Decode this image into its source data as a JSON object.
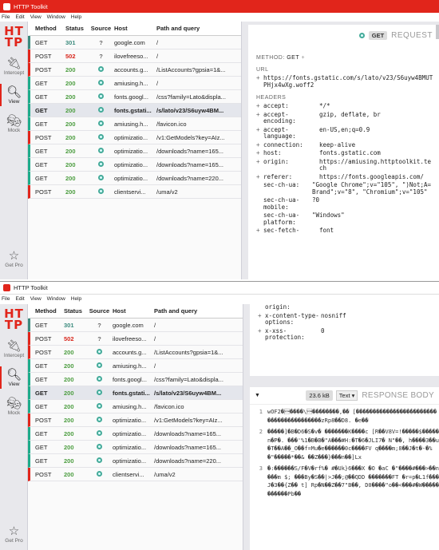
{
  "app": {
    "title": "HTTP Toolkit",
    "logo_line1": "HT",
    "logo_line2": "TP"
  },
  "menu": [
    "File",
    "Edit",
    "View",
    "Window",
    "Help"
  ],
  "nav": {
    "intercept": "Intercept",
    "view": "View",
    "mock": "Mock",
    "get_pro": "Get Pro"
  },
  "columns": {
    "method": "Method",
    "status": "Status",
    "source": "Source",
    "host": "Host",
    "path": "Path and query"
  },
  "rows": [
    {
      "method": "GET",
      "status": "301",
      "source": "?",
      "host": "google.com",
      "path": "/"
    },
    {
      "method": "POST",
      "status": "502",
      "source": "?",
      "host": "ilovefreeso...",
      "path": "/"
    },
    {
      "method": "POST",
      "status": "200",
      "source": "chrome",
      "host": "accounts.g...",
      "path": "/ListAccounts?gpsia=1&..."
    },
    {
      "method": "GET",
      "status": "200",
      "source": "chrome",
      "host": "amiusing.h...",
      "path": "/"
    },
    {
      "method": "GET",
      "status": "200",
      "source": "chrome",
      "host": "fonts.googl...",
      "path": "/css?family=Lato&displa..."
    },
    {
      "method": "GET",
      "status": "200",
      "source": "chrome",
      "host": "fonts.gstati...",
      "path": "/s/lato/v23/S6uyw4BM..."
    },
    {
      "method": "GET",
      "status": "200",
      "source": "chrome",
      "host": "amiusing.h...",
      "path": "/favicon.ico"
    },
    {
      "method": "POST",
      "status": "200",
      "source": "chrome",
      "host": "optimizatio...",
      "path": "/v1:GetModels?key=AIz..."
    },
    {
      "method": "GET",
      "status": "200",
      "source": "chrome",
      "host": "optimizatio...",
      "path": "/downloads?name=165..."
    },
    {
      "method": "GET",
      "status": "200",
      "source": "chrome",
      "host": "optimizatio...",
      "path": "/downloads?name=165..."
    },
    {
      "method": "GET",
      "status": "200",
      "source": "chrome",
      "host": "optimizatio...",
      "path": "/downloads?name=220..."
    },
    {
      "method": "POST",
      "status": "200",
      "source": "chrome",
      "host": "clientservi...",
      "path": "/uma/v2"
    }
  ],
  "request": {
    "method_pill": "GET",
    "title": "REQUEST",
    "method_label": "METHOD:",
    "method_value": "GET",
    "url_label": "URL",
    "url": "https://fonts.gstatic.com/s/lato/v23/S6uyw4BMUTPHjx4wXg.woff2",
    "headers_label": "HEADERS",
    "headers": [
      {
        "k": "accept:",
        "v": "*/*",
        "plus": true
      },
      {
        "k": "accept-encoding:",
        "v": "gzip, deflate, br",
        "plus": true
      },
      {
        "k": "accept-language:",
        "v": "en-US,en;q=0.9",
        "plus": true
      },
      {
        "k": "connection:",
        "v": "keep-alive",
        "plus": true
      },
      {
        "k": "host:",
        "v": "fonts.gstatic.com",
        "plus": true
      },
      {
        "k": "origin:",
        "v": "https://amiusing.httptoolkit.tech",
        "plus": true
      },
      {
        "k": "referer:",
        "v": "https://fonts.googleapis.com/",
        "plus": true
      },
      {
        "k": "sec-ch-ua:",
        "v": "\"Google Chrome\";v=\"105\", \")Not;A=Brand\";v=\"8\", \"Chromium\";v=\"105\"",
        "plus": false
      },
      {
        "k": "sec-ch-ua-mobile:",
        "v": "?0",
        "plus": false
      },
      {
        "k": "sec-ch-ua-platform:",
        "v": "\"Windows\"",
        "plus": false
      },
      {
        "k": "sec-fetch-",
        "v": "font",
        "plus": true
      }
    ]
  },
  "response_headers_tail": [
    {
      "k": "origin:",
      "v": "",
      "plus": false
    },
    {
      "k": "x-content-type-options:",
      "v": "nosniff",
      "plus": true
    },
    {
      "k": "x-xss-protection:",
      "v": "0",
      "plus": true
    }
  ],
  "response_body": {
    "size": "23.6 kB",
    "format": "Text",
    "title": "RESPONSE BODY",
    "lines": [
      {
        "n": "1",
        "text": "wOF2\u0000\u0001\u0000\u0000\u0000\u0000\\\u0001\u0000\u0000\u0000\u0000\u0000\u0000\u0000\u0000,\u0000\u0000 [\u0000\u0000\u0000\u0000\u0000\u0000\u0000\u0000\u0000\u0000\u0000\u0000\u0000\u0000\u0000\u0000\u0000\u0000\u0000\u0000\u0000\u0000\u0000\u0000\u0000\u0000\u0000\u0000\u0000\u0000\u0000\u0000\u0000\u0000\u0000\u0000\u0000\u0000\u0000\u0000zRp8\u0000\u0000D8. \u0000e\u0000\u0000"
      },
      {
        "n": "2",
        "text": "\u0000\u0000\u0000\u0000\u0000]\u0000B\u0000D6\u0000S\u0000v\u0000 \u0000\u0000\u0000\u0000\u0000\u0000\u0000K\u0000\u0000\u0000\u0000c [R\u0000\u0000V8V=!\u0000\u0000\u0000\u0000\u0000$\u0000\u0000\u0000\u0000\u0000n\u0000P\u0000. \u0000\u0000\u0000'%1\u0000B\u0000B\u0000\"A\u0000\u0000\u0000#H:\u0000T\u00006\u0000JLI7\u0000 N\"\u0000\u0000, h\u0000\u0000\u0000\u00003\u0000\u0000u\u0000T\u0000\u0000A\u0000\u0000_O\u0000\u0000f=Mu\u0000e\u0000\u0000\u0000\u0000\u0000\u00000c\u0000\u0000\u0000\u0000FV q\u0000\u0000\u0000\u0000m;8\u0000\u0000J\u0000t\u0000-\u0000%\u0000\"\u0000\u0000\u0000\u0000\u0000*\u0000\u0000& \u0000\u0000Z\u0000\u0000\u0000}\u0000\u0000\u0000n\u0000\u0000]Lx"
      },
      {
        "n": "3",
        "text": "\u0000:\u0000\u0000\u0000\u0000\u0000\u0000S/F\u0000V\u0000rf%\u0000 #\u0000Uk}6\u0000\u0000\u0000X \u0000O \u0000aC \u0000\"\u0000\u0000\u0000\u0000#\u0000\u0000\u0000>\u0000\u0000n\u0000\u0000\u0000m $; \u0000\u0000\u0000By\u0000S\u0000\u0000|>J\u0000\u0000;@\u0000\u0000QDD \u0000\u0000\u0000\u0000\u0000\u0000\u0000FT \u0000r=p\u0000L1f\u0000\u0000\u0000J\u00003\u0000\u0000{Z\u0000\u0000 t] Rp\u0000N\u0000\u0000Z\u0000\u00007\"B\u0000\u0000, D0\u0000\u0000\u0000\u0000\"o\u0000\u0000<\u0000\u0000\u0000#\u0000W\u0000\u0000\u0000\u0000\u0000\u0000\u0000\u0000\u0000\u0000\u0000Pb\u0000\u0000"
      }
    ]
  },
  "colors": {
    "brand": "#e1251b",
    "ok": "#4c9d40",
    "error": "#d8261c"
  }
}
